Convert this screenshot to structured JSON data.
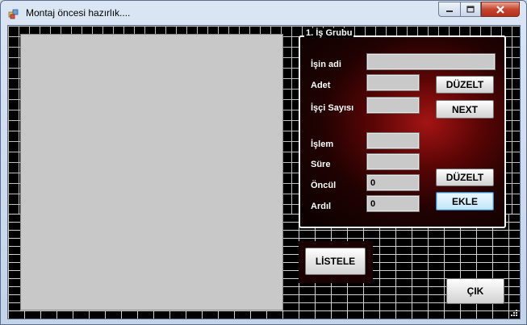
{
  "window": {
    "title": "Montaj öncesi hazırlık....",
    "controls": {
      "minimize": "minimize",
      "maximize": "maximize",
      "close": "close"
    }
  },
  "group": {
    "legend": "1. İş Grubu",
    "labels": {
      "isin_adi": "İşin adi",
      "adet": "Adet",
      "isci_sayisi": "İşçi Sayısı",
      "islem": "İşlem",
      "sure": "Süre",
      "oncul": "Öncül",
      "ardil": "Ardıl"
    },
    "fields": {
      "isin_adi": "",
      "adet": "",
      "isci_sayisi": "",
      "islem": "",
      "sure": "",
      "oncul": "0",
      "ardil": "0"
    },
    "buttons": {
      "duzelt_top": "DÜZELT",
      "next": "NEXT",
      "duzelt_bottom": "DÜZELT",
      "ekle": "EKLE"
    }
  },
  "buttons": {
    "listele": "LİSTELE",
    "cik": "ÇIK"
  },
  "colors": {
    "group_bg": "#5a0505",
    "panel_bg": "#c8c8c8",
    "grid": "#c8c8c8"
  }
}
